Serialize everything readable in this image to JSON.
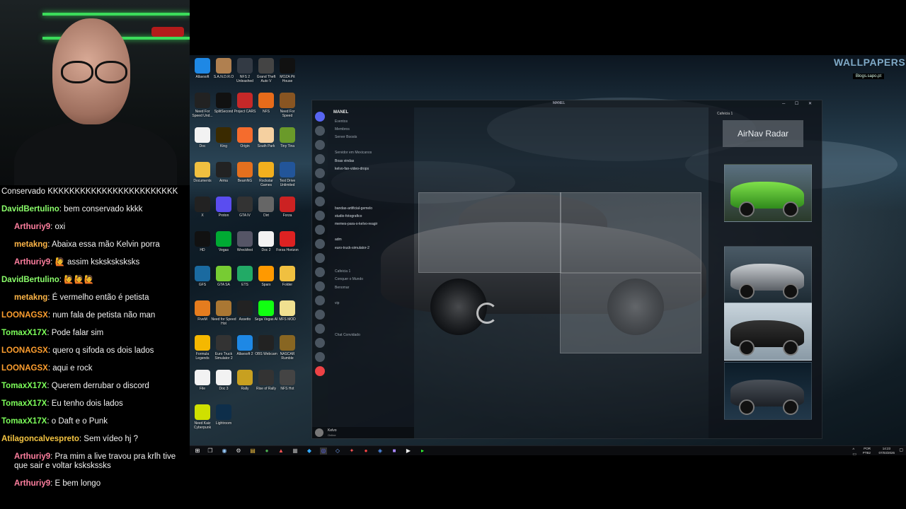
{
  "chat": {
    "messages": [
      {
        "user": "",
        "text": "Conservado KKKKKKKKKKKKKKKKKKKKKKKK",
        "color": "#ffffff",
        "indent": false
      },
      {
        "user": "DavidBertulino",
        "text": ": bem conservado kkkk",
        "color": "#8bff6b",
        "indent": false
      },
      {
        "user": "Arthuriy9",
        "text": ": oxi",
        "color": "#ff7f9f",
        "indent": true
      },
      {
        "user": "metakng",
        "text": ": Abaixa essa mão Kelvin porra",
        "color": "#ffb648",
        "indent": true
      },
      {
        "user": "Arthuriy9",
        "text": ": 🙋 assim ksksksksksks",
        "color": "#ff7f9f",
        "indent": true
      },
      {
        "user": "DavidBertulino",
        "text": ": 🙋🙋🙋",
        "color": "#8bff6b",
        "indent": false
      },
      {
        "user": "metakng",
        "text": ": É vermelho então é petista",
        "color": "#ffb648",
        "indent": true
      },
      {
        "user": "LOONAGSX",
        "text": ": num fala de petista não man",
        "color": "#ff9f2f",
        "indent": false
      },
      {
        "user": "TomaxX17X",
        "text": ": Pode falar sim",
        "color": "#7dff5a",
        "indent": false
      },
      {
        "user": "LOONAGSX",
        "text": ": quero q sifoda os dois lados",
        "color": "#ff9f2f",
        "indent": false
      },
      {
        "user": "LOONAGSX",
        "text": ": aqui e rock",
        "color": "#ff9f2f",
        "indent": false
      },
      {
        "user": "TomaxX17X",
        "text": ": Querem derrubar o discord",
        "color": "#7dff5a",
        "indent": false
      },
      {
        "user": "TomaxX17X",
        "text": ": Eu tenho dois lados",
        "color": "#7dff5a",
        "indent": false
      },
      {
        "user": "TomaxX17X",
        "text": ": o Daft e o Punk",
        "color": "#7dff5a",
        "indent": false
      },
      {
        "user": "Atilagoncalvespreto",
        "text": ": Sem vídeo hj ?",
        "color": "#f5c542",
        "indent": false
      },
      {
        "user": "Arthuriy9",
        "text": ": Pra mim a live travou pra krlh tive que sair e voltar kskskssks",
        "color": "#ff7f9f",
        "indent": true
      },
      {
        "user": "Arthuriy9",
        "text": ": E bem longo",
        "color": "#ff7f9f",
        "indent": true
      }
    ]
  },
  "wallpaper": {
    "logo": "WALLPAPERS",
    "sub": "Blogs.sapo.pt"
  },
  "desktop_icons": [
    {
      "label": "Allavsoft",
      "color": "#1e88e5"
    },
    {
      "label": "S.A.N.D.R.O",
      "color": "#b08050"
    },
    {
      "label": "NFS 2 Unleashed",
      "color": "#333a44"
    },
    {
      "label": "Grand Theft Auto V",
      "color": "#444"
    },
    {
      "label": "MOZA Pit House",
      "color": "#111"
    },
    {
      "label": "Need For Speed Und...",
      "color": "#222"
    },
    {
      "label": "SplitSecond",
      "color": "#111"
    },
    {
      "label": "Project CARS",
      "color": "#c62828"
    },
    {
      "label": "NFS",
      "color": "#e66b1a"
    },
    {
      "label": "Need For Speed",
      "color": "#885522"
    },
    {
      "label": "Doc",
      "color": "#f2f2f2"
    },
    {
      "label": "King",
      "color": "#3a2a00"
    },
    {
      "label": "Origin",
      "color": "#f56c2d"
    },
    {
      "label": "South Park",
      "color": "#f5d0a0"
    },
    {
      "label": "Tiny Tina",
      "color": "#6a9a2a"
    },
    {
      "label": "Documents",
      "color": "#f0c040"
    },
    {
      "label": "Arma",
      "color": "#222"
    },
    {
      "label": "BeamNG",
      "color": "#e4701e"
    },
    {
      "label": "Rockstar Games",
      "color": "#f2b01e"
    },
    {
      "label": "Test Drive Unlimited",
      "color": "#225599"
    },
    {
      "label": "X",
      "color": "#222"
    },
    {
      "label": "Proton",
      "color": "#5a4df0"
    },
    {
      "label": "GTA IV",
      "color": "#333"
    },
    {
      "label": "Dirt",
      "color": "#666"
    },
    {
      "label": "Forza",
      "color": "#c22"
    },
    {
      "label": "HD",
      "color": "#111"
    },
    {
      "label": "Vegas",
      "color": "#0a3"
    },
    {
      "label": "Wreckfest",
      "color": "#556"
    },
    {
      "label": "Doc 2",
      "color": "#f2f2f2"
    },
    {
      "label": "Forza Horizon",
      "color": "#d22"
    },
    {
      "label": "GFS",
      "color": "#1a6aa0"
    },
    {
      "label": "GTA SA",
      "color": "#7c3"
    },
    {
      "label": "ETS",
      "color": "#2a6"
    },
    {
      "label": "Sparx",
      "color": "#f90"
    },
    {
      "label": "Folder",
      "color": "#f0c040"
    },
    {
      "label": "FiveM",
      "color": "#e57c1e"
    },
    {
      "label": "Need for Speed Hot",
      "color": "#aa7733"
    },
    {
      "label": "Assetto",
      "color": "#222"
    },
    {
      "label": "Sega Vegas AI",
      "color": "#1f1"
    },
    {
      "label": "MFS MOD",
      "color": "#f0e090"
    },
    {
      "label": "Formula Legends",
      "color": "#f5b800"
    },
    {
      "label": "Euro Truck Simulator 2",
      "color": "#333"
    },
    {
      "label": "Allavsoft 2",
      "color": "#1e88e5"
    },
    {
      "label": "OBS Webcam",
      "color": "#222"
    },
    {
      "label": "NASCAR Rumble",
      "color": "#886622"
    },
    {
      "label": "File",
      "color": "#f2f2f2"
    },
    {
      "label": "Doc 3",
      "color": "#f2f2f2"
    },
    {
      "label": "Rally",
      "color": "#c8a020"
    },
    {
      "label": "Rise of Rally",
      "color": "#333"
    },
    {
      "label": "NFS Hot",
      "color": "#444"
    },
    {
      "label": "Need Kaiz Cyberpunk",
      "color": "#cfe000"
    },
    {
      "label": "Lightroom",
      "color": "#0e2e4a"
    }
  ],
  "discord": {
    "window_title": "MANEL",
    "server_name": "MANEL",
    "channels": [
      "Eventos",
      "Membros",
      "Server Boosts",
      "",
      "Servidor em Mexicanos",
      "Boas vindas",
      "kelvo-fan-video-drops",
      "",
      "",
      "",
      "",
      "bandas-artificial-gemelo",
      "studio-fotografico",
      "memes-para-o-kelvo-reagir",
      "",
      "adm",
      "euro-truck-simulator-2",
      "",
      "",
      "Cafeicia 1",
      "Conquer o Mundo",
      "Benomar",
      "",
      "vip",
      "",
      "",
      "",
      "Chat Convidado"
    ],
    "user_name": "Kelvo",
    "user_status": "Online",
    "voice_title": "Cafeicia 1",
    "airnav_label": "AirNav Radar"
  },
  "taskbar": {
    "lang": "POR",
    "lang2": "PTB2",
    "time": "14:23",
    "date": "07/03/2026"
  }
}
